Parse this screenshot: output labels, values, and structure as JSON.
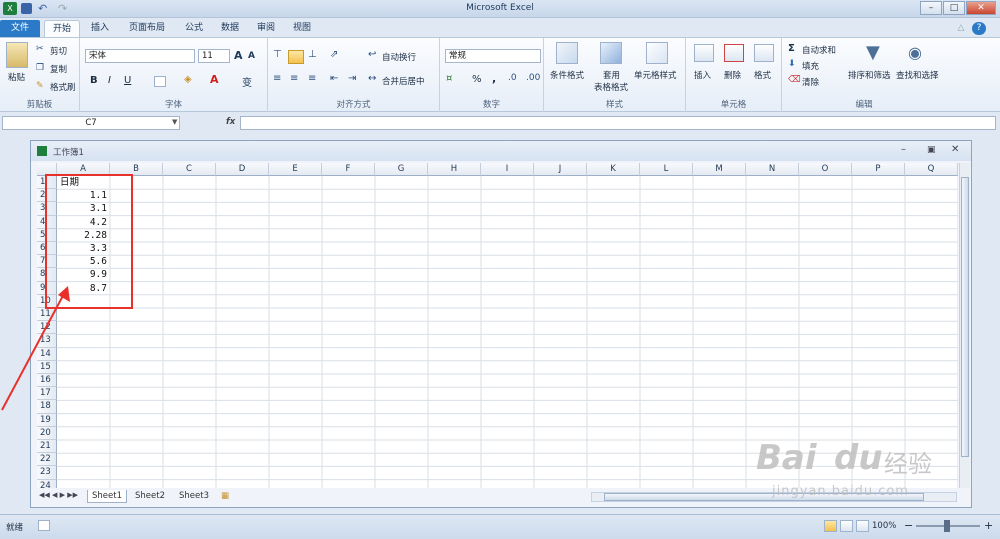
{
  "app_title": "Microsoft Excel",
  "quick_access": [
    "excel-icon",
    "save-icon",
    "undo-icon",
    "redo-icon"
  ],
  "window_buttons": {
    "minimize": "–",
    "restore": "□",
    "close": "✕"
  },
  "help_glyph": "?",
  "tabs": [
    {
      "label": "文件"
    },
    {
      "label": "开始"
    },
    {
      "label": "插入"
    },
    {
      "label": "页面布局"
    },
    {
      "label": "公式"
    },
    {
      "label": "数据"
    },
    {
      "label": "审阅"
    },
    {
      "label": "视图"
    }
  ],
  "ribbon": {
    "clipboard": {
      "paste": "粘贴",
      "cut": "剪切",
      "copy": "复制",
      "painter": "格式刷",
      "group": "剪贴板"
    },
    "font": {
      "name": "宋体",
      "size": "11",
      "bold": "B",
      "italic": "I",
      "underline": "U",
      "grow": "A",
      "shrink": "A",
      "fontcolor": "A",
      "wen": "变",
      "group": "字体"
    },
    "alignment": {
      "wrap": "自动换行",
      "merge": "合并后居中",
      "group": "对齐方式"
    },
    "number": {
      "format": "常规",
      "percent": "%",
      "comma": ",",
      "group": "数字"
    },
    "styles": {
      "cond": "条件格式",
      "table1": "套用",
      "table2": "表格格式",
      "cell": "单元格样式",
      "group": "样式"
    },
    "cells": {
      "insert": "插入",
      "delete": "删除",
      "format": "格式",
      "group": "单元格"
    },
    "editing": {
      "autosum": "自动求和",
      "fill": "填充",
      "clear": "清除",
      "sort": "排序和筛选",
      "find": "查找和选择",
      "group": "编辑",
      "sigma": "Σ"
    }
  },
  "formula_bar": {
    "name_box": "C7",
    "fx": "fx",
    "content": ""
  },
  "workbook": {
    "title": "工作簿1"
  },
  "columns": [
    "A",
    "B",
    "C",
    "D",
    "E",
    "F",
    "G",
    "H",
    "I",
    "J",
    "K",
    "L",
    "M",
    "N",
    "O",
    "P",
    "Q"
  ],
  "rows": [
    "1",
    "2",
    "3",
    "4",
    "5",
    "6",
    "7",
    "8",
    "9",
    "10",
    "11",
    "12",
    "13",
    "14",
    "15",
    "16",
    "17",
    "18",
    "19",
    "20",
    "21",
    "22",
    "23",
    "24"
  ],
  "cells": {
    "A1": "日期",
    "A2": "1.1",
    "A3": "3.1",
    "A4": "4.2",
    "A5": "2.28",
    "A6": "3.3",
    "A7": "5.6",
    "A8": "9.9",
    "A9": "8.7"
  },
  "sheets": [
    {
      "label": "Sheet1"
    },
    {
      "label": "Sheet2"
    },
    {
      "label": "Sheet3"
    }
  ],
  "status": {
    "ready": "就绪",
    "zoom": "100%",
    "minus": "−",
    "plus": "+"
  },
  "colors": {
    "file_tab": "#2a7ac7",
    "annotation": "#e8312b",
    "watermark": "#bfbfbf"
  },
  "watermark": {
    "brand": "Bai",
    "brand2": "du",
    "suffix": "经验",
    "url": "jingyan.baidu.com"
  }
}
